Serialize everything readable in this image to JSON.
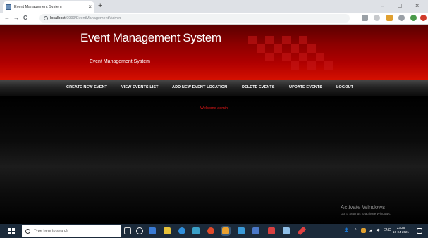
{
  "browser": {
    "tab_title": "Event Management System",
    "tab_close": "×",
    "new_tab": "+",
    "window_controls": {
      "minimize": "–",
      "maximize": "□",
      "close": "×"
    },
    "nav": {
      "back": "←",
      "forward": "→",
      "reload": "C"
    },
    "url_host": "localhost",
    "url_path": ":9999/EventManagement/Admin"
  },
  "header": {
    "title": "Event Management System",
    "subtitle": "Event Management System"
  },
  "navbar": {
    "items": [
      {
        "label": "CREATE NEW EVENT"
      },
      {
        "label": "VIEW EVENTS LIST"
      },
      {
        "label": "ADD NEW EVENT LOCATION"
      },
      {
        "label": "DELETE EVENTS"
      },
      {
        "label": "UPDATE EVENTS"
      },
      {
        "label": "LOGOUT"
      }
    ]
  },
  "main": {
    "welcome": "Welcome admin"
  },
  "watermark": {
    "line1": "Activate Windows",
    "line2": "Go to Settings to activate Windows."
  },
  "taskbar": {
    "search_placeholder": "Type here to search",
    "time": "23:26",
    "date": "16-04-2021",
    "lang": "ENG"
  },
  "colors": {
    "header_red": "#b00000",
    "welcome_text": "#e01818",
    "taskbar": "#1b2a3a"
  }
}
